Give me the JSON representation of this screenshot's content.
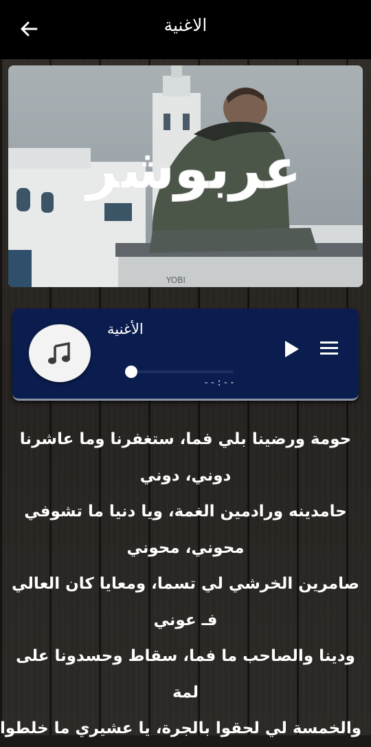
{
  "appbar": {
    "title": "الاغنية",
    "back_icon": "arrow-left-icon"
  },
  "cover": {
    "overlay_text": "عربوشر",
    "corner_text": "YOBI"
  },
  "player": {
    "song_title": "الأغنية",
    "time": "--:--",
    "progress": 0,
    "icons": [
      "music-note-icon",
      "play-icon",
      "menu-icon"
    ],
    "colors": {
      "background": "#0b1d4e",
      "accent": "#ffffff"
    }
  },
  "lyrics": [
    "حومة ورضينا بلي فما، ستغفرنا وما عاشرنا",
    "دوني، دوني",
    "حامدينه ورادمين الغمة، ويا دنيا ما تشوفي",
    "محوني، محوني",
    "صامرين الخرشي لي تسما، ومعايا كان العالي",
    "فـ عوني",
    "ودينا والصاحب ما فما، سقاط وحسدونا على",
    "لمة",
    "والخمسة لي لحقوا بالجرة، يا عشيري ما خلطوا"
  ]
}
